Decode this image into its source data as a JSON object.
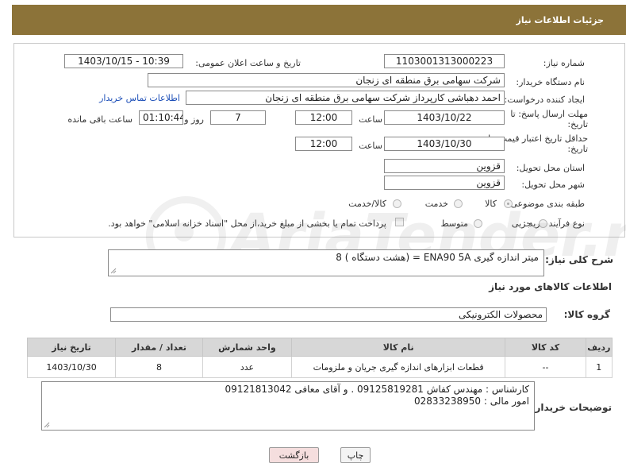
{
  "header": {
    "title": "جزئیات اطلاعات نیاز"
  },
  "form": {
    "need_number_label": "شماره نیاز:",
    "need_number": "1103001313000223",
    "announce_label": "تاریخ و ساعت اعلان عمومی:",
    "announce_value": "1403/10/15 - 10:39",
    "buyer_org_label": "نام دستگاه خریدار:",
    "buyer_org": "شرکت سهامی برق منطقه ای زنجان",
    "creator_label": "ایجاد کننده درخواست:",
    "creator": "احمد دهباشی کارپرداز شرکت سهامی برق منطقه ای زنجان",
    "contact_link": "اطلاعات تماس خریدار",
    "deadline_label": "مهلت ارسال پاسخ: تا تاریخ:",
    "deadline_date": "1403/10/22",
    "time_label": "ساعت",
    "deadline_time": "12:00",
    "days_value": "7",
    "days_label": "روز و",
    "remaining_value": "01:10:44",
    "remaining_label": "ساعت باقی مانده",
    "price_validity_label": "حداقل تاریخ اعتبار قیمت: تا تاریخ:",
    "price_validity_date": "1403/10/30",
    "price_validity_time": "12:00",
    "province_label": "استان محل تحویل:",
    "province": "قزوین",
    "city_label": "شهر محل تحویل:",
    "city": "قزوین",
    "category_label": "طبقه بندی موضوعی:",
    "category_options": [
      "کالا",
      "خدمت",
      "کالا/خدمت"
    ],
    "process_label": "نوع فرآیند خرید :",
    "process_options": [
      "جزیی",
      "متوسط"
    ],
    "payment_note": "پرداخت تمام یا بخشی از مبلغ خرید،از محل \"اسناد خزانه اسلامی\" خواهد بود."
  },
  "summary": {
    "label": "شرح کلی نیاز:",
    "text": "میتر اندازه گیری  ENA90 5A = (هشت دستگاه ) 8"
  },
  "goods_section_title": "اطلاعات کالاهای مورد نیاز",
  "goods_group": {
    "label": "گروه کالا:",
    "value": "محصولات الکترونیکی"
  },
  "table": {
    "headers": [
      "ردیف",
      "کد کالا",
      "نام کالا",
      "واحد شمارش",
      "تعداد / مقدار",
      "تاریخ نیاز"
    ],
    "rows": [
      [
        "1",
        "--",
        "قطعات ابزارهای اندازه گیری جریان و ملزومات",
        "عدد",
        "8",
        "1403/10/30"
      ]
    ]
  },
  "buyer_notes": {
    "label": "توضیحات خریدار:",
    "line1": "کارشناس : مهندس کفاش 09125819281  . و آقای معافی 09121813042",
    "line2": "امور مالی : 02833238950"
  },
  "buttons": {
    "print": "چاپ",
    "back": "بازگشت"
  },
  "watermark": "AriaTender.neT",
  "colors": {
    "header": "#8c7339",
    "link": "#1d4fb8",
    "back_button": "#f5dede"
  }
}
